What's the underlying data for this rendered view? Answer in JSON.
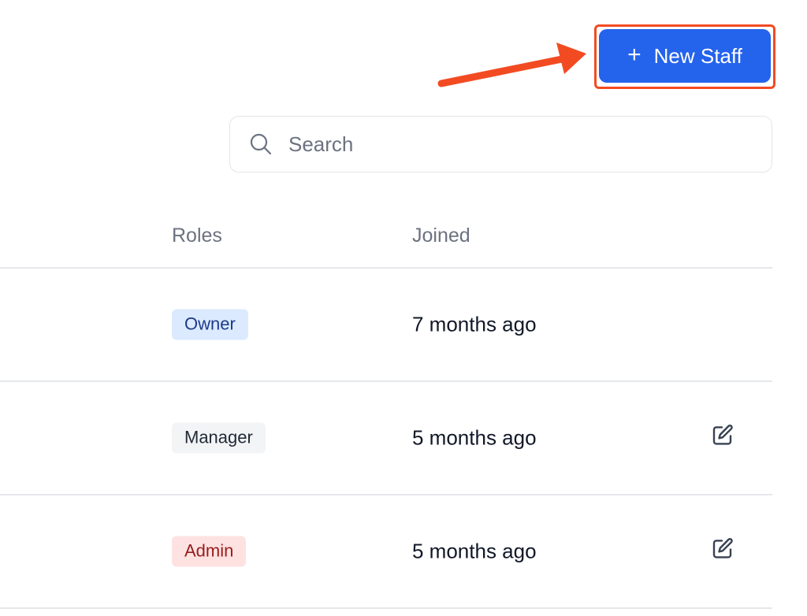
{
  "toolbar": {
    "new_staff_label": "New Staff",
    "new_staff_icon": "plus-icon"
  },
  "search": {
    "placeholder": "Search",
    "icon": "search-icon"
  },
  "table": {
    "columns": [
      "Roles",
      "Joined"
    ],
    "rows": [
      {
        "role": "Owner",
        "role_color": "#1e3a8a",
        "role_bg": "#dbeafe",
        "joined": "7 months ago",
        "editable": false
      },
      {
        "role": "Manager",
        "role_color": "#1f2937",
        "role_bg": "#f3f4f6",
        "joined": "5 months ago",
        "editable": true
      },
      {
        "role": "Admin",
        "role_color": "#991b1b",
        "role_bg": "#fee2e2",
        "joined": "5 months ago",
        "editable": true
      }
    ]
  },
  "colors": {
    "primary": "#2463eb",
    "annotation": "#f24b22"
  }
}
